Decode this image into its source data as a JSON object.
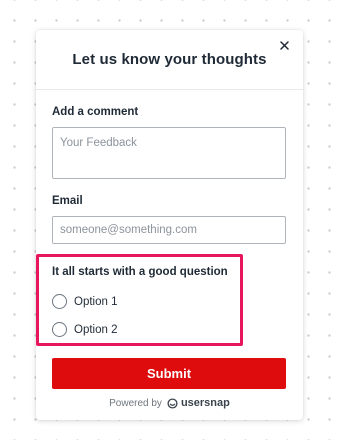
{
  "widget": {
    "title": "Let us know your thoughts",
    "close_icon": "close-icon",
    "comment": {
      "label": "Add a comment",
      "placeholder": "Your Feedback",
      "value": ""
    },
    "email": {
      "label": "Email",
      "placeholder": "someone@something.com",
      "value": ""
    },
    "question": {
      "label": "It all starts with a good question",
      "options": [
        {
          "label": "Option 1",
          "selected": false
        },
        {
          "label": "Option 2",
          "selected": false
        }
      ],
      "highlight_color": "#e8175d"
    },
    "submit_label": "Submit",
    "submit_color": "#de0c0c",
    "footer": {
      "powered_by": "Powered by",
      "brand_icon": "usersnap-logo-icon",
      "brand": "usersnap"
    }
  }
}
